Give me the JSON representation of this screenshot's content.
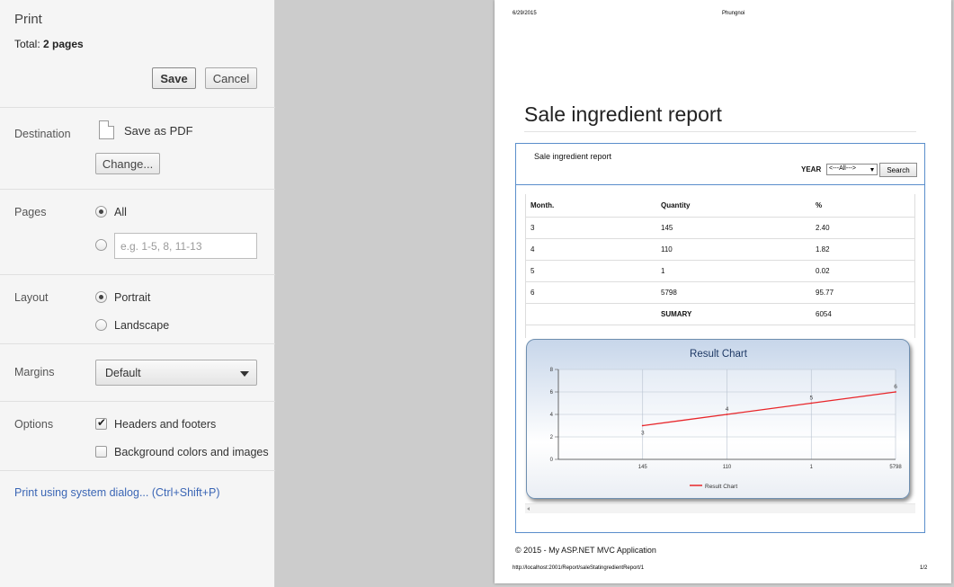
{
  "panel": {
    "title": "Print",
    "total_label": "Total:",
    "total_value": "2 pages",
    "save_label": "Save",
    "cancel_label": "Cancel",
    "destination": {
      "label": "Destination",
      "name": "Save as PDF",
      "change_label": "Change..."
    },
    "pages": {
      "label": "Pages",
      "all_label": "All",
      "range_placeholder": "e.g. 1-5, 8, 11-13",
      "selected": "All"
    },
    "layout": {
      "label": "Layout",
      "portrait_label": "Portrait",
      "landscape_label": "Landscape",
      "selected": "Portrait"
    },
    "margins": {
      "label": "Margins",
      "value": "Default"
    },
    "options": {
      "label": "Options",
      "headers_footers_label": "Headers and footers",
      "headers_footers_checked": true,
      "background_label": "Background colors and images",
      "background_checked": false
    },
    "system_dialog_link": "Print using system dialog... (Ctrl+Shift+P)"
  },
  "preview": {
    "header_date": "6/29/2015",
    "header_title": "Phungnoi",
    "report_title": "Sale ingredient report",
    "panel_title": "Sale ingredient report",
    "year_label": "YEAR",
    "year_value": "<---All--->",
    "search_label": "Search",
    "table": {
      "headers": [
        "Month.",
        "Quantity",
        "%"
      ],
      "rows": [
        [
          "3",
          "145",
          "2.40"
        ],
        [
          "4",
          "110",
          "1.82"
        ],
        [
          "5",
          "1",
          "0.02"
        ],
        [
          "6",
          "5798",
          "95.77"
        ]
      ],
      "summary": [
        "",
        "SUMARY",
        "6054"
      ]
    },
    "footer_copy": "© 2015 - My ASP.NET MVC Application",
    "footer_url": "http://localhost:2001/Report/saleStatingredientReport/1",
    "footer_page": "1/2"
  },
  "chart_data": {
    "type": "line",
    "title": "Result Chart",
    "categories": [
      "145",
      "110",
      "1",
      "5798"
    ],
    "series": [
      {
        "name": "Result Chart",
        "values": [
          3,
          4,
          5,
          6
        ],
        "labels": [
          "3",
          "4",
          "5",
          "6"
        ]
      }
    ],
    "ylim": [
      0,
      8
    ],
    "yticks": [
      "0",
      "2",
      "4",
      "6",
      "8"
    ],
    "grid": true,
    "legend": "bottom",
    "colors": {
      "line": "#e8262a",
      "grid": "#b8c2cf",
      "title": "#1f3a66"
    }
  }
}
